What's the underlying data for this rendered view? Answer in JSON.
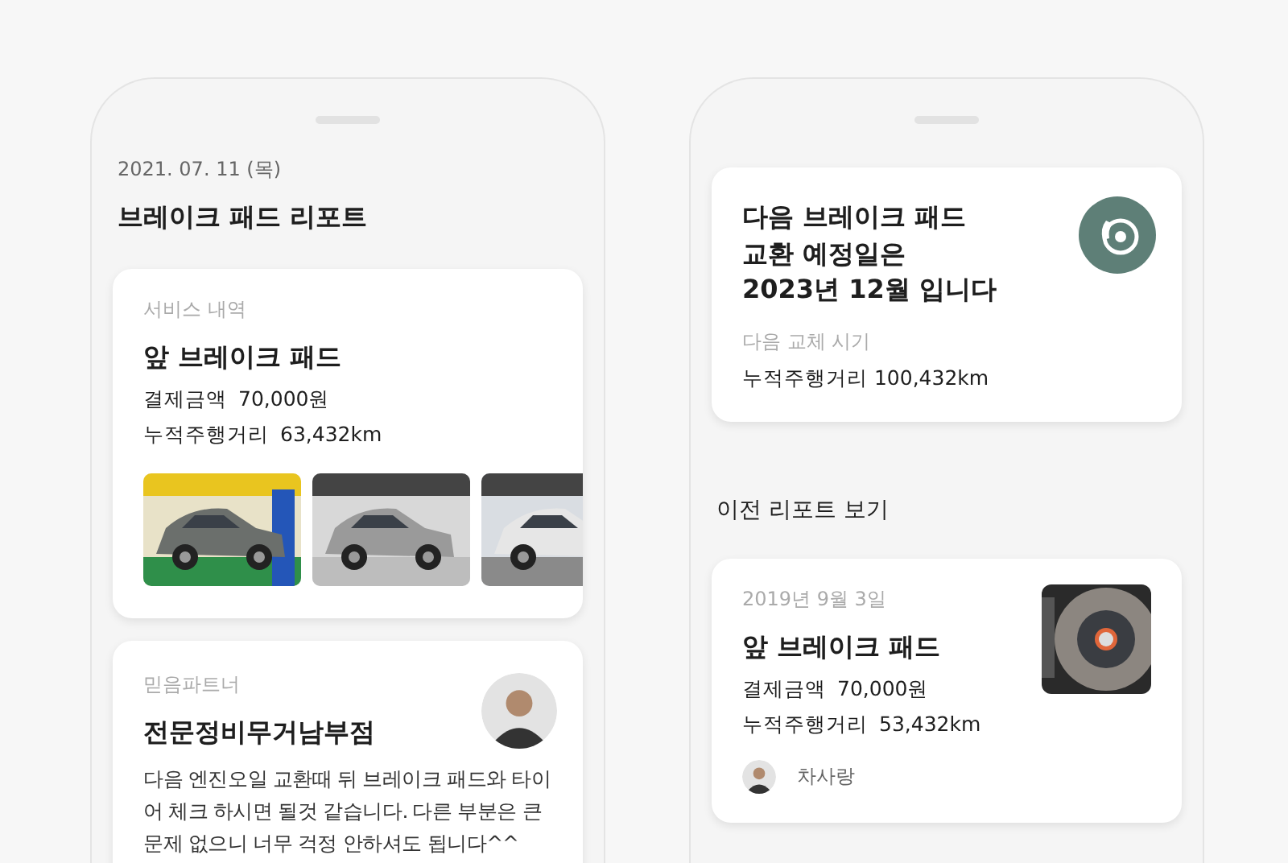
{
  "left_screen": {
    "date": "2021. 07. 11 (목)",
    "title": "브레이크 패드 리포트",
    "service_card": {
      "label": "서비스 내역",
      "item": "앞 브레이크 패드",
      "details": [
        {
          "label": "결제금액",
          "value": "70,000원"
        },
        {
          "label": "누적주행거리",
          "value": "63,432km"
        }
      ]
    },
    "partner_card": {
      "label": "믿음파트너",
      "name": "전문정비무거남부점",
      "message": "다음 엔진오일 교환때 뒤 브레이크 패드와 타이어 체크 하시면 될것 같습니다. 다른 부분은 큰 문제 없으니 너무 걱정 안하셔도 됩니다^^"
    }
  },
  "right_screen": {
    "next_card": {
      "headline": "다음 브레이크 패드\n교환 예정일은\n2023년 12월 입니다",
      "label": "다음 교체 시기",
      "mileage": "누적주행거리 100,432km"
    },
    "section_title": "이전 리포트 보기",
    "report_card": {
      "date": "2019년 9월 3일",
      "item": "앞 브레이크 패드",
      "details": [
        {
          "label": "결제금액",
          "value": "70,000원"
        },
        {
          "label": "누적주행거리",
          "value": "53,432km"
        }
      ],
      "author": "차사랑"
    }
  }
}
